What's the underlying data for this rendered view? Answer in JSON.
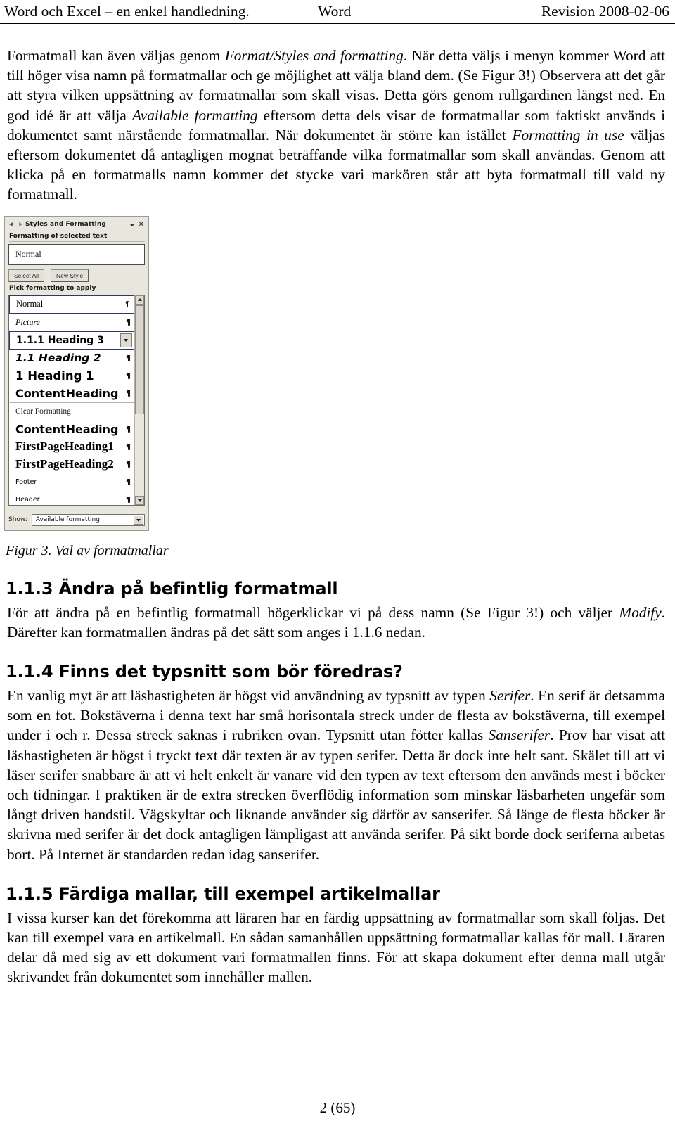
{
  "header": {
    "left": "Word och Excel – en enkel handledning.",
    "center": "Word",
    "right": "Revision 2008-02-06"
  },
  "body": {
    "paragraph1": {
      "seg1": "Formatmall kan även väljas genom ",
      "em1": "Format/Styles and formatting",
      "seg2": ". När detta väljs i menyn kommer Word att till höger visa namn på formatmallar och ge möjlighet att välja bland dem. (Se Figur 3!) Observera att det går att styra vilken uppsättning av formatmallar som skall visas. Detta görs genom rullgardinen längst ned. En god idé är att välja ",
      "em2": "Available formatting",
      "seg3": " eftersom detta dels visar de formatmallar som faktiskt används i dokumentet samt närstående formatmallar. När dokumentet är större kan istället ",
      "em3": "Formatting in use",
      "seg4": " väljas eftersom dokumentet då antagligen mognat beträffande vilka formatmallar som skall användas. Genom att klicka på en formatmalls namn kommer det stycke vari markören står att byta formatmall till vald ny formatmall."
    },
    "figure_caption": "Figur 3. Val av formatmallar",
    "section_113": {
      "heading": "1.1.3 Ändra på befintlig formatmall",
      "seg1": "För att ändra på en befintlig formatmall högerklickar vi på dess namn (Se Figur 3!) och väljer ",
      "em1": "Modify",
      "seg2": ". Därefter kan formatmallen ändras på det sätt som anges i 1.1.6 nedan."
    },
    "section_114": {
      "heading": "1.1.4 Finns det typsnitt som bör föredras?",
      "seg1": "En vanlig myt är att läshastigheten är högst vid användning av typsnitt av typen ",
      "em1": "Serifer",
      "seg2": ". En serif är detsamma som en fot. Bokstäverna i denna text har små horisontala streck under de flesta av bokstäverna, till exempel under i och r. Dessa streck saknas i rubriken ovan. Typsnitt utan fötter kallas ",
      "em2": "Sanserifer",
      "seg3": ". Prov har visat att läshastigheten är högst i tryckt text där texten är av typen serifer. Detta är dock inte helt sant. Skälet till att vi läser serifer snabbare är att vi helt enkelt är vanare vid den typen av text eftersom den används mest i böcker och tidningar. I praktiken är de extra strecken överflödig information som minskar läsbarheten ungefär som långt driven handstil. Vägskyltar och liknande använder sig därför av sanserifer. Så länge de flesta böcker är skrivna med serifer är det dock antagligen lämpligast att använda serifer. På sikt borde dock seriferna arbetas bort. På Internet är standarden redan idag sanserifer."
    },
    "section_115": {
      "heading": "1.1.5 Färdiga mallar, till exempel artikelmallar",
      "text": "I vissa kurser kan det förekomma att läraren har en färdig uppsättning av formatmallar som skall följas. Det kan till exempel vara en artikelmall. En sådan samanhållen uppsättning formatmallar kallas för mall. Läraren delar då med sig av ett dokument vari formatmallen finns. För att skapa dokument efter denna mall utgår skrivandet från dokumentet som innehåller mallen."
    }
  },
  "figure": {
    "pane_title": "Styles and Formatting",
    "close_glyph": "✕",
    "label_selected": "Formatting of selected text",
    "selected_style": "Normal",
    "buttons": [
      {
        "label": "Select All"
      },
      {
        "label": "New Style"
      }
    ],
    "label_pick": "Pick formatting to apply",
    "style_list": [
      {
        "name": "Normal",
        "pilcrow": "¶"
      },
      {
        "name": "Picture",
        "pilcrow": "¶"
      },
      {
        "name": "1.1.1  Heading 3",
        "pilcrow": ""
      },
      {
        "name": "1.1  Heading 2",
        "pilcrow": "¶"
      },
      {
        "name": "1  Heading 1",
        "pilcrow": "¶"
      },
      {
        "name": "ContentHeading",
        "pilcrow": "¶"
      },
      {
        "name": "Clear Formatting",
        "pilcrow": ""
      },
      {
        "name": "ContentHeading",
        "pilcrow": "¶"
      },
      {
        "name": "FirstPageHeading1",
        "pilcrow": "¶"
      },
      {
        "name": "FirstPageHeading2",
        "pilcrow": "¶"
      },
      {
        "name": "Footer",
        "pilcrow": "¶"
      },
      {
        "name": "Header",
        "pilcrow": "¶"
      }
    ],
    "show_label": "Show:",
    "show_value": "Available formatting"
  },
  "footer": {
    "page": "2 (65)"
  }
}
